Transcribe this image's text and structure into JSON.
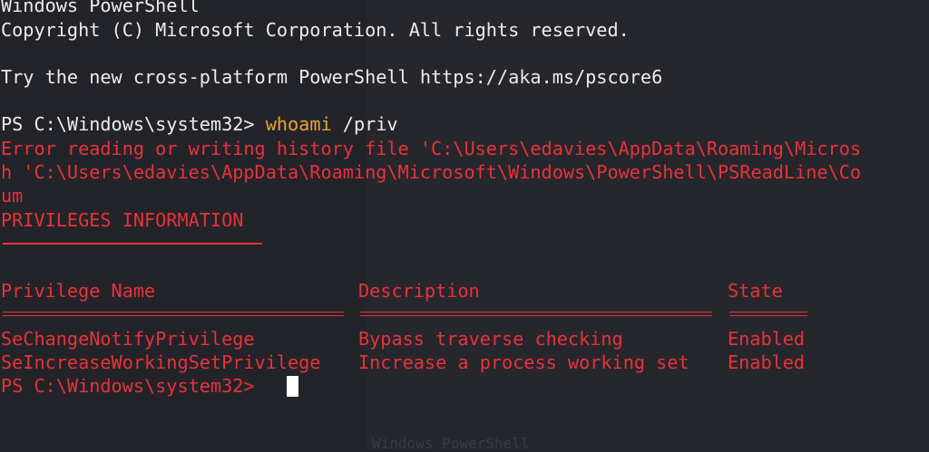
{
  "window": {
    "ghost_title": "Windows PowerShell"
  },
  "terminal": {
    "header_title": "Windows PowerShell",
    "copyright": "Copyright (C) Microsoft Corporation. All rights reserved.",
    "try_text": "Try the new cross-platform PowerShell https://aka.ms/pscore6",
    "prompt": "PS C:\\Windows\\system32> ",
    "command": "whoami",
    "command_args": " /priv",
    "error_line1": "Error reading or writing history file 'C:\\Users\\edavies\\AppData\\Roaming\\Micros",
    "error_line2": "h 'C:\\Users\\edavies\\AppData\\Roaming\\Microsoft\\Windows\\PowerShell\\PSReadLine\\Co",
    "error_line3": "um",
    "section_title": "PRIVILEGES INFORMATION",
    "table": {
      "headers": [
        "Privilege Name",
        "Description",
        "State"
      ],
      "rows": [
        [
          "SeChangeNotifyPrivilege",
          "Bypass traverse checking",
          "Enabled"
        ],
        [
          "SeIncreaseWorkingSetPrivilege",
          "Increase a process working set",
          "Enabled"
        ]
      ]
    },
    "final_prompt": "PS C:\\Windows\\system32> "
  },
  "colors": {
    "background": "#232429",
    "foreground": "#ececec",
    "error": "#e8323a",
    "command": "#e8a13a",
    "cursor": "#ffffff"
  }
}
